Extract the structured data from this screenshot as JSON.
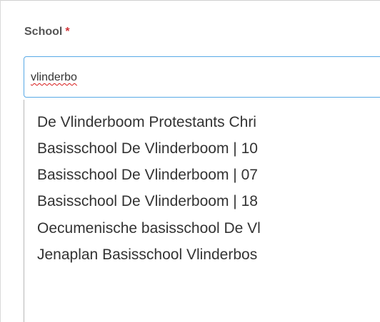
{
  "form": {
    "label": "School",
    "required_marker": "*"
  },
  "search": {
    "value": "vlinderbo"
  },
  "results": [
    "De Vlinderboom Protestants Chri",
    "Basisschool De Vlinderboom | 10",
    "Basisschool De Vlinderboom | 07",
    "Basisschool De Vlinderboom | 18",
    "Oecumenische basisschool De Vl",
    "Jenaplan Basisschool Vlinderbos"
  ],
  "colors": {
    "focus_border": "#58a9e6",
    "required": "#d13438",
    "spellcheck_underline": "#d81b1b"
  }
}
